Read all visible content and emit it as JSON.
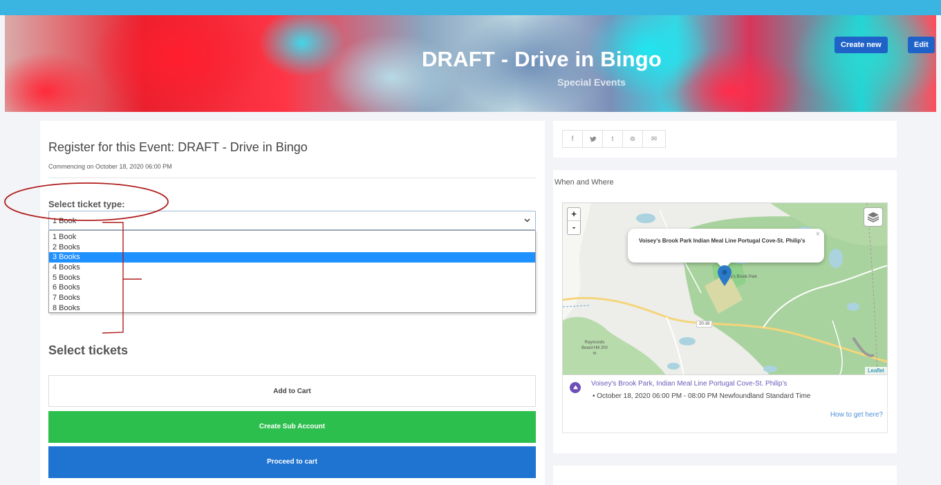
{
  "header": {
    "title": "DRAFT - Drive in Bingo",
    "subtitle": "Special Events",
    "create_new_label": "Create new",
    "edit_label": "Edit"
  },
  "registration": {
    "title": "Register for this Event: DRAFT - Drive in Bingo",
    "commencing": "Commencing on October 18, 2020 06:00 PM",
    "select_label": "Select ticket type:",
    "selected_value": "1 Book",
    "options": [
      "1 Book",
      "2 Books",
      "3 Books",
      "4 Books",
      "5 Books",
      "6 Books",
      "7 Books",
      "8 Books"
    ],
    "highlighted_option": "3 Books",
    "select_tickets_heading": "Select tickets",
    "add_to_cart_label": "Add to Cart",
    "create_sub_account_label": "Create Sub Account",
    "proceed_label": "Proceed to cart"
  },
  "social": {
    "icons": [
      "facebook-icon",
      "twitter-icon",
      "tumblr-icon",
      "pinterest-icon",
      "email-icon"
    ],
    "glyphs": [
      "f",
      "y",
      "t",
      "⊚",
      "✉"
    ]
  },
  "where": {
    "title": "When and Where",
    "zoom_in": "+",
    "zoom_out": "-",
    "popup_text": "Voisey's Brook Park Indian Meal Line Portugal Cove-St. Philip's",
    "popup_close": "×",
    "map_labels": {
      "road": "20-16",
      "hill": "Raymonds Beard Hill 200 m",
      "park": "Voisey's Brook Park"
    },
    "attribution": "Leaflet",
    "location_link": "Voisey's Brook Park, Indian Meal Line Portugal Cove-St. Philip's",
    "date_line": "• October 18, 2020 06:00 PM - 08:00 PM Newfoundland Standard Time",
    "how_link": "How to get here?"
  },
  "colors": {
    "topbar": "#3ab4e0",
    "primary_button": "#1f63c9",
    "green_button": "#2dbf4e",
    "blue_button": "#1f74d2",
    "selected_option": "#1e90ff",
    "annotation": "#b01c1c"
  }
}
